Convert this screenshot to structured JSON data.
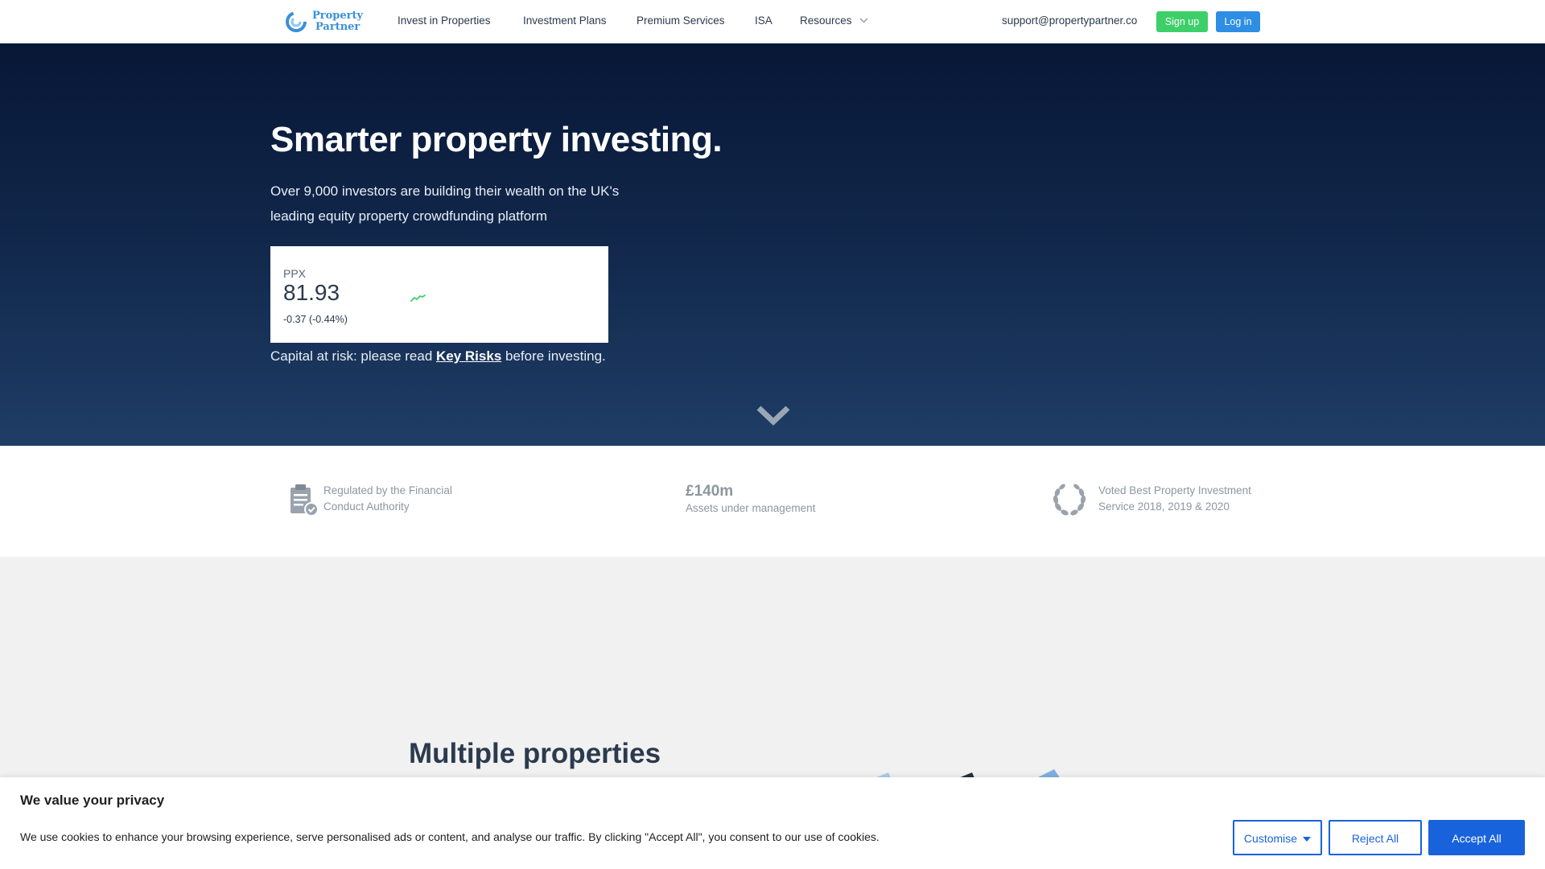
{
  "nav": {
    "logo_line1": "Property",
    "logo_line2": "Partner",
    "links": [
      "Invest in Properties",
      "Investment Plans",
      "Premium Services",
      "ISA",
      "Resources"
    ],
    "support_email": "support@propertypartner.co",
    "signup_label": "Sign up",
    "login_label": "Log in"
  },
  "hero": {
    "title": "Smarter property investing.",
    "subtitle": "Over 9,000 investors are building their wealth on the UK's leading equity property crowdfunding platform",
    "ppx": {
      "name": "PPX",
      "value": "81.93",
      "change": "-0.37 (-0.44%)"
    },
    "risk_prefix": "Capital at risk: please read ",
    "risk_link": "Key Risks",
    "risk_suffix": " before investing."
  },
  "stats": [
    {
      "icon": "clipboard-check-icon",
      "line1": "Regulated by the Financial",
      "line2": "Conduct Authority"
    },
    {
      "headline": "£140m",
      "line2": "Assets under management"
    },
    {
      "icon": "laurel-wreath-icon",
      "line1": "Voted Best Property Investment",
      "line2": "Service 2018, 2019 & 2020"
    }
  ],
  "section": {
    "title": "Multiple properties"
  },
  "cookie": {
    "title": "We value your privacy",
    "text": "We use cookies to enhance your browsing experience, serve personalised ads or content, and analyse our traffic. By clicking \"Accept All\", you consent to our use of cookies.",
    "customise_label": "Customise",
    "reject_label": "Reject All",
    "accept_label": "Accept All"
  },
  "colors": {
    "hero_top": "#081736",
    "hero_bottom": "#1f3d66",
    "signup": "#3ecf6b",
    "login": "#2d8ee3",
    "cookie_accent": "#1863dc",
    "brand": "#3b8fd6"
  }
}
